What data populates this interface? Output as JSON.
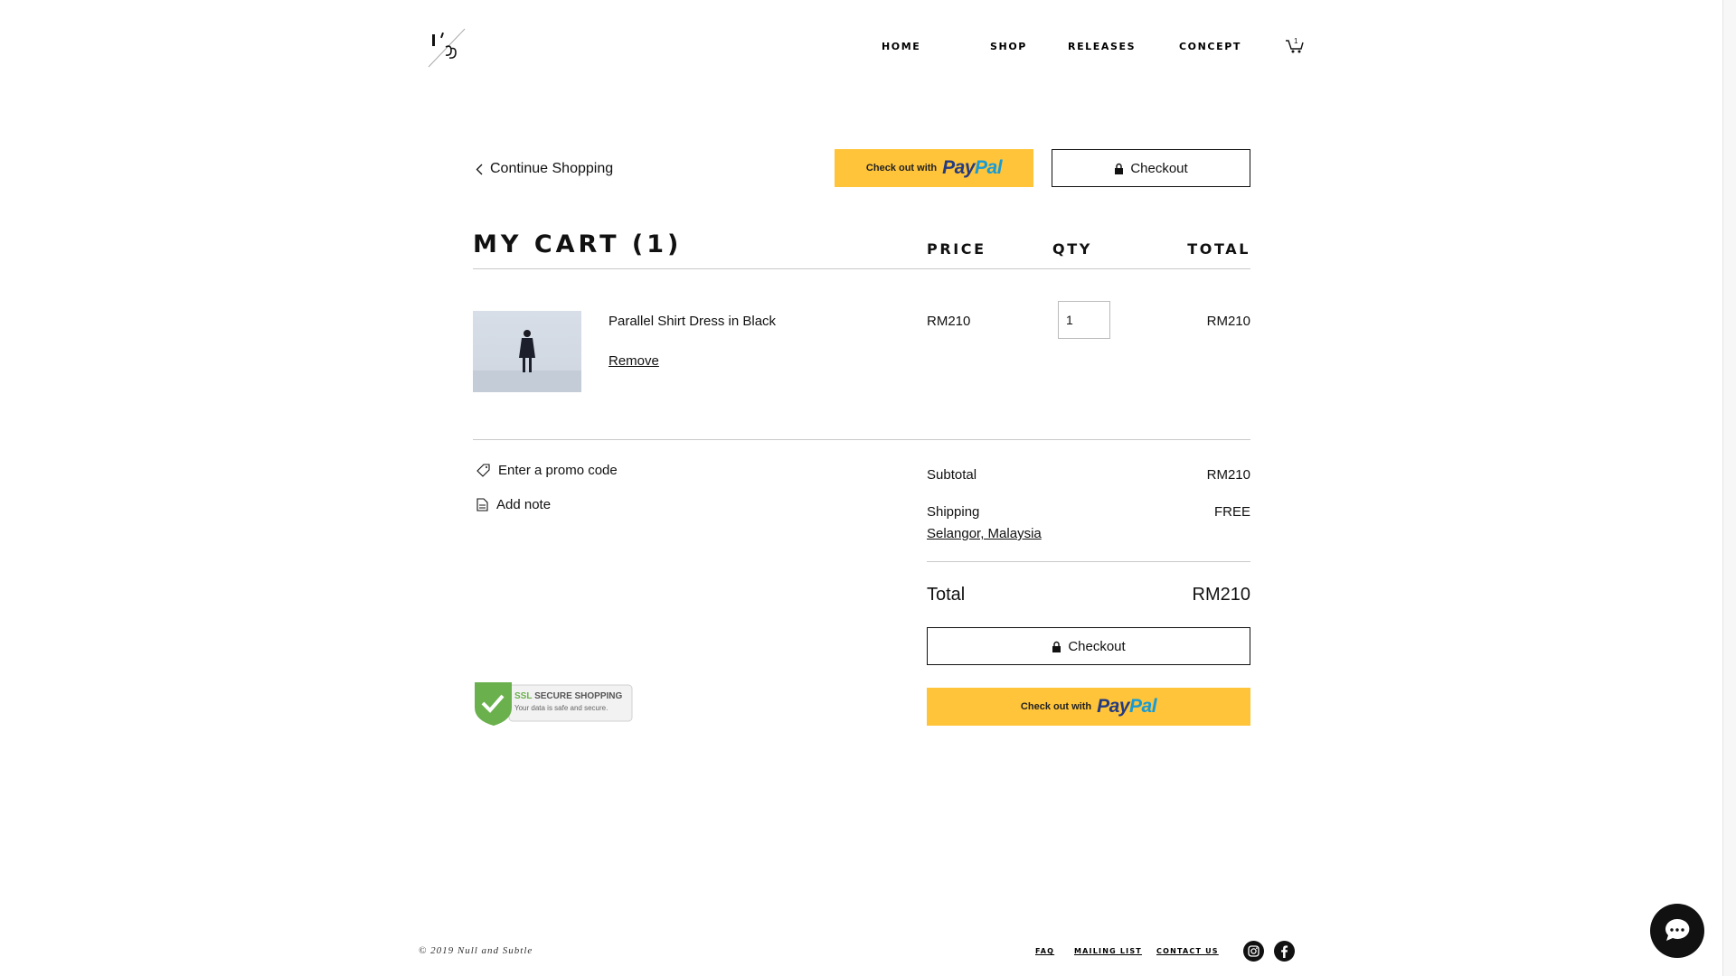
{
  "header": {
    "nav": {
      "home": "HOME",
      "shop": "SHOP",
      "releases": "RELEASES",
      "concept": "CONCEPT"
    },
    "cart_count": "1"
  },
  "actions": {
    "continue_shopping": "Continue Shopping",
    "paypal_prefix": "Check out with",
    "paypal_word_a": "Pay",
    "paypal_word_b": "Pal",
    "checkout": "Checkout"
  },
  "cart": {
    "title": "MY CART (1)",
    "columns": {
      "price": "PRICE",
      "qty": "QTY",
      "total": "TOTAL"
    },
    "items": [
      {
        "name": "Parallel Shirt Dress in Black",
        "remove": "Remove",
        "price": "RM210",
        "qty": "1",
        "total": "RM210"
      }
    ]
  },
  "extras": {
    "promo": "Enter a promo code",
    "note": "Add note"
  },
  "summary": {
    "subtotal_label": "Subtotal",
    "subtotal": "RM210",
    "shipping_label": "Shipping",
    "shipping": "FREE",
    "shipping_location": "Selangor, Malaysia",
    "total_label": "Total",
    "total": "RM210"
  },
  "badge": {
    "ssl": "SSL",
    "line1": "SECURE SHOPPING",
    "line2": "Your data is safe and secure."
  },
  "footer": {
    "copyright": "© 2019 Null and Subtle",
    "links": {
      "faq": "FAQ",
      "mailing": "MAILING LIST",
      "contact": "CONTACT US"
    }
  },
  "colors": {
    "paypal_yellow": "#ffc439",
    "paypal_dark": "#253b80",
    "paypal_light": "#179bd7",
    "ssl_green": "#6ab04c"
  }
}
